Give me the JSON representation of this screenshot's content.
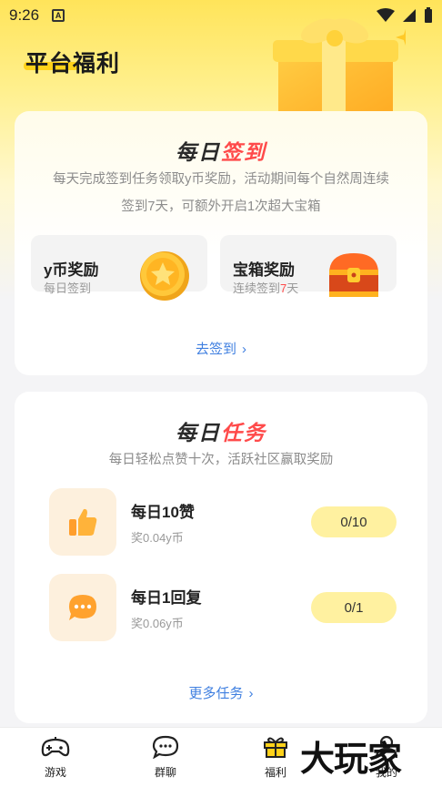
{
  "status_bar": {
    "time": "9:26",
    "notif_icon_letter": "A"
  },
  "page": {
    "title": "平台福利"
  },
  "sign_card": {
    "title_part1": "每日",
    "title_part2": "签到",
    "desc_line1": "每天完成签到任务领取y币奖励，活动期间每个自然周连续",
    "desc_line2": "签到7天，可额外开启1次超大宝箱",
    "rewards": [
      {
        "name": "y币奖励",
        "sub": "每日签到",
        "icon": "coin-icon"
      },
      {
        "name": "宝箱奖励",
        "sub_prefix": "连续签到",
        "sub_highlight": "7",
        "sub_suffix": "天",
        "icon": "treasure-chest-icon"
      }
    ],
    "link_label": "去签到"
  },
  "task_card": {
    "title_part1": "每日",
    "title_part2": "任务",
    "desc": "每日轻松点赞十次，活跃社区赢取奖励",
    "tasks": [
      {
        "name": "每日10赞",
        "reward": "奖0.04y币",
        "progress": "0/10",
        "icon": "thumbs-up-icon"
      },
      {
        "name": "每日1回复",
        "reward": "奖0.06y币",
        "progress": "0/1",
        "icon": "chat-bubble-icon"
      }
    ],
    "more_label": "更多任务"
  },
  "tab_bar": {
    "tabs": [
      {
        "label": "游戏",
        "icon": "gamepad-icon"
      },
      {
        "label": "群聊",
        "icon": "chat-icon"
      },
      {
        "label": "福利",
        "icon": "gift-icon"
      },
      {
        "label": "我的",
        "icon": "user-icon"
      }
    ]
  },
  "watermark": "大玩家",
  "colors": {
    "accent_yellow": "#ffd21a",
    "highlight_red": "#ff4a4a",
    "link_blue": "#3f7fe0"
  }
}
